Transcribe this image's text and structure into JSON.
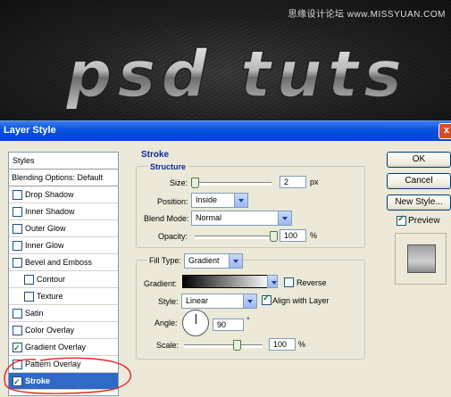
{
  "watermark": "思缘设计论坛 www.MISSYUAN.COM",
  "banner_text": "psd tuts",
  "dialog": {
    "title": "Layer Style",
    "close_label": "x"
  },
  "styles_list": {
    "header": "Styles",
    "blending_options": "Blending Options: Default",
    "items": [
      {
        "label": "Drop Shadow",
        "checked": false
      },
      {
        "label": "Inner Shadow",
        "checked": false
      },
      {
        "label": "Outer Glow",
        "checked": false
      },
      {
        "label": "Inner Glow",
        "checked": false
      },
      {
        "label": "Bevel and Emboss",
        "checked": false
      },
      {
        "label": "Contour",
        "checked": false
      },
      {
        "label": "Texture",
        "checked": false
      },
      {
        "label": "Satin",
        "checked": false
      },
      {
        "label": "Color Overlay",
        "checked": false
      },
      {
        "label": "Gradient Overlay",
        "checked": true
      },
      {
        "label": "Pattern Overlay",
        "checked": false
      },
      {
        "label": "Stroke",
        "checked": true
      }
    ]
  },
  "stroke": {
    "section_title": "Stroke",
    "structure_title": "Structure",
    "size_label": "Size:",
    "size_value": "2",
    "size_unit": "px",
    "size_slider_fraction": 0.02,
    "position_label": "Position:",
    "position_value": "Inside",
    "blend_mode_label": "Blend Mode:",
    "blend_mode_value": "Normal",
    "opacity_label": "Opacity:",
    "opacity_value": "100",
    "opacity_unit": "%",
    "opacity_fraction": 1.0,
    "fill_type_label": "Fill Type:",
    "fill_type_value": "Gradient",
    "gradient_label": "Gradient:",
    "reverse_label": "Reverse",
    "reverse_checked": false,
    "style_label": "Style:",
    "style_value": "Linear",
    "align_label": "Align with Layer",
    "align_checked": true,
    "angle_label": "Angle:",
    "angle_value": "90",
    "angle_unit": "°",
    "scale_label": "Scale:",
    "scale_value": "100",
    "scale_unit": "%",
    "scale_fraction": 0.67
  },
  "buttons": {
    "ok": "OK",
    "cancel": "Cancel",
    "new_style": "New Style...",
    "preview_label": "Preview",
    "preview_checked": true
  }
}
